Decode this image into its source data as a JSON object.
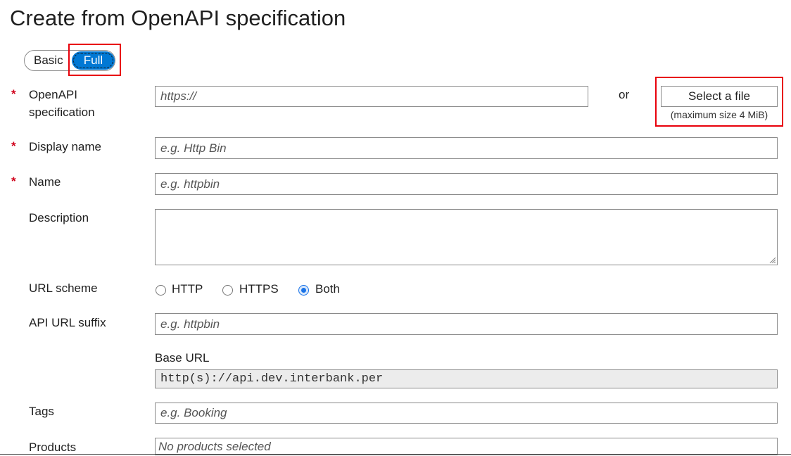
{
  "page": {
    "title": "Create from OpenAPI specification"
  },
  "mode_toggle": {
    "basic": "Basic",
    "full": "Full",
    "selected": "Full"
  },
  "fields": {
    "openapi_spec": {
      "label_line1": "OpenAPI",
      "label_line2": "specification",
      "required_mark": "*",
      "placeholder": "https://",
      "or_text": "or",
      "file_button": "Select a file",
      "file_note": "(maximum size 4 MiB)"
    },
    "display_name": {
      "label": "Display name",
      "required_mark": "*",
      "placeholder": "e.g. Http Bin"
    },
    "name": {
      "label": "Name",
      "required_mark": "*",
      "placeholder": "e.g. httpbin"
    },
    "description": {
      "label": "Description",
      "value": ""
    },
    "url_scheme": {
      "label": "URL scheme",
      "options": [
        "HTTP",
        "HTTPS",
        "Both"
      ],
      "selected": "Both"
    },
    "api_url_suffix": {
      "label": "API URL suffix",
      "placeholder": "e.g. httpbin"
    },
    "base_url": {
      "label": "Base URL",
      "value": "http(s)://api.dev.interbank.per"
    },
    "tags": {
      "label": "Tags",
      "placeholder": "e.g. Booking"
    },
    "products": {
      "label": "Products",
      "placeholder": "No products selected"
    }
  },
  "colors": {
    "accent": "#0078d4",
    "required": "#d0021b",
    "highlight": "#e8000b"
  }
}
